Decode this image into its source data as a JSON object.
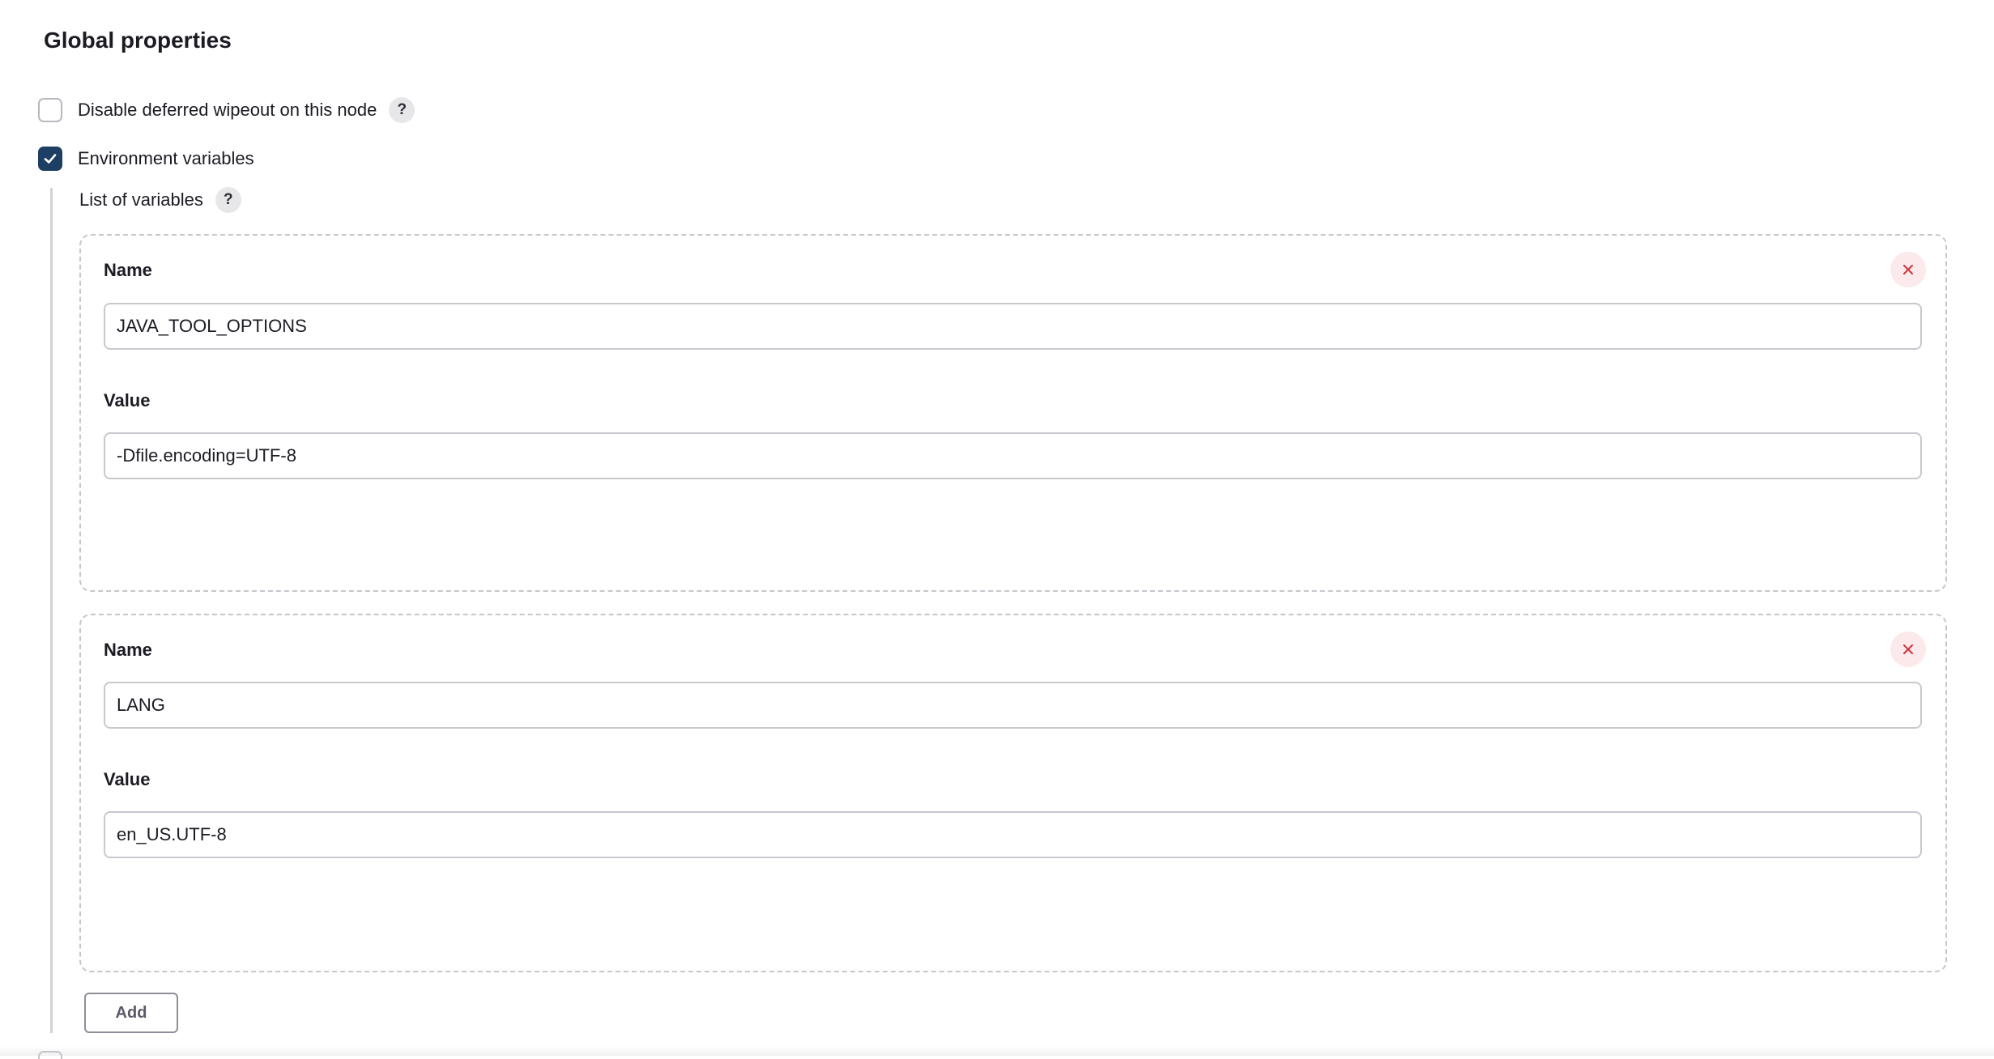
{
  "section": {
    "title": "Global properties"
  },
  "options": {
    "disable_deferred_wipeout": {
      "label": "Disable deferred wipeout on this node",
      "checked": false,
      "help": "?"
    },
    "environment_variables": {
      "label": "Environment variables",
      "checked": true
    }
  },
  "env": {
    "list_label": "List of variables",
    "list_help": "?",
    "variables": [
      {
        "name_label": "Name",
        "name": "JAVA_TOOL_OPTIONS",
        "value_label": "Value",
        "value": "-Dfile.encoding=UTF-8"
      },
      {
        "name_label": "Name",
        "name": "LANG",
        "value_label": "Value",
        "value": "en_US.UTF-8"
      }
    ],
    "add_label": "Add"
  },
  "colors": {
    "checkbox_checked": "#1e3f64",
    "remove_icon": "#d0343c",
    "remove_bg": "#fbe9eb"
  },
  "icons": {
    "checkmark": "check-icon",
    "remove": "close-icon",
    "help": "help-icon"
  }
}
